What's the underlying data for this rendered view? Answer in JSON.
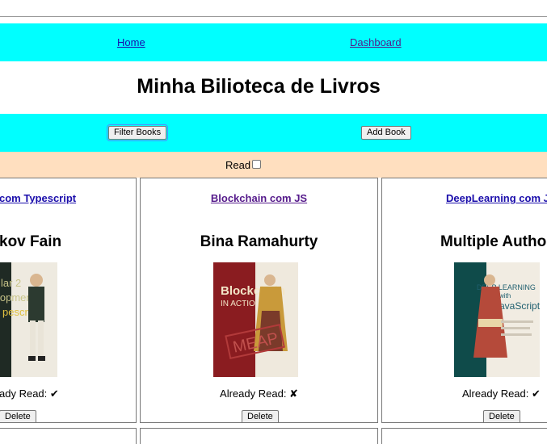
{
  "nav": {
    "home": "Home",
    "dashboard": "Dashboard"
  },
  "page_title": "Minha Bilioteca de Livros",
  "toolbar": {
    "filter": "Filter Books",
    "add": "Add Book"
  },
  "read_filter": {
    "label": "Read"
  },
  "books": [
    {
      "title": "com Typescript",
      "author": "kov Fain",
      "read_label": "ady Read: ✔",
      "delete": "Delete"
    },
    {
      "title": "Blockchain com JS",
      "author": "Bina Ramahurty",
      "read_label": "Already Read: ✘",
      "delete": "Delete"
    },
    {
      "title": "DeepLearning com J",
      "author": "Multiple Author",
      "read_label": "Already Read: ✔",
      "delete": "Delete"
    }
  ],
  "covers": [
    {
      "text_lines": [
        "lar 2",
        "lopment",
        "pescript"
      ]
    },
    {
      "text_lines": [
        "Blockchain",
        "IN ACTION",
        "MEAP"
      ]
    },
    {
      "text_lines": [
        "DEEP LEARNING",
        "with",
        "JavaScript"
      ]
    }
  ],
  "colors": {
    "nav_bg": "#00ffff",
    "read_bar_bg": "#ffdfbf"
  }
}
